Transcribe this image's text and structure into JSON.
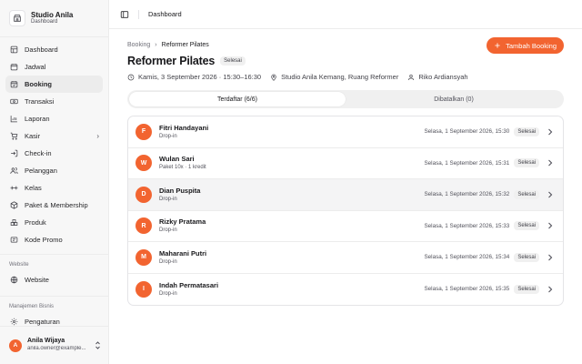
{
  "brand": {
    "name": "Studio Anila",
    "subtitle": "Dashboard"
  },
  "sidebar": {
    "items": [
      {
        "label": "Dashboard",
        "icon": "dashboard-icon"
      },
      {
        "label": "Jadwal",
        "icon": "calendar-icon"
      },
      {
        "label": "Booking",
        "icon": "booking-icon",
        "active": true
      },
      {
        "label": "Transaksi",
        "icon": "banknote-icon"
      },
      {
        "label": "Laporan",
        "icon": "chart-icon"
      },
      {
        "label": "Kasir",
        "icon": "cart-icon",
        "has_submenu": true
      },
      {
        "label": "Check-in",
        "icon": "checkin-icon"
      },
      {
        "label": "Pelanggan",
        "icon": "users-icon"
      },
      {
        "label": "Kelas",
        "icon": "dumbbell-icon"
      },
      {
        "label": "Paket & Membership",
        "icon": "package-icon"
      },
      {
        "label": "Produk",
        "icon": "product-icon"
      },
      {
        "label": "Kode Promo",
        "icon": "ticket-icon"
      }
    ],
    "website_section": {
      "label": "Website",
      "items": [
        {
          "label": "Website",
          "icon": "globe-icon"
        }
      ]
    },
    "business_section": {
      "label": "Manajemen Bisnis",
      "items": [
        {
          "label": "Pengaturan",
          "icon": "settings-icon"
        }
      ]
    }
  },
  "user": {
    "name": "Anila Wijaya",
    "email": "anila.owner@example...",
    "initial": "A"
  },
  "topbar": {
    "title": "Dashboard"
  },
  "breadcrumb": {
    "parent": "Booking",
    "current": "Reformer Pilates"
  },
  "page": {
    "title": "Reformer Pilates",
    "status": "Selesai",
    "datetime": "Kamis, 3 September 2026 · 15:30–16:30",
    "location": "Studio Anila Kemang, Ruang Reformer",
    "instructor": "Riko Ardiansyah",
    "add_button": "Tambah Booking"
  },
  "tabs": [
    {
      "label": "Terdaftar (6/6)",
      "active": true
    },
    {
      "label": "Dibatalkan (0)",
      "active": false
    }
  ],
  "bookings": [
    {
      "initial": "F",
      "name": "Fitri Handayani",
      "plan": "Drop-in",
      "time": "Selasa, 1 September 2026, 15:30",
      "status": "Selesai"
    },
    {
      "initial": "W",
      "name": "Wulan Sari",
      "plan": "Paket 10x · 1 kredit",
      "time": "Selasa, 1 September 2026, 15:31",
      "status": "Selesai"
    },
    {
      "initial": "D",
      "name": "Dian Puspita",
      "plan": "Drop-in",
      "time": "Selasa, 1 September 2026, 15:32",
      "status": "Selesai",
      "hover": true
    },
    {
      "initial": "R",
      "name": "Rizky Pratama",
      "plan": "Drop-in",
      "time": "Selasa, 1 September 2026, 15:33",
      "status": "Selesai"
    },
    {
      "initial": "M",
      "name": "Maharani Putri",
      "plan": "Drop-in",
      "time": "Selasa, 1 September 2026, 15:34",
      "status": "Selesai"
    },
    {
      "initial": "I",
      "name": "Indah Permatasari",
      "plan": "Drop-in",
      "time": "Selasa, 1 September 2026, 15:35",
      "status": "Selesai"
    }
  ],
  "colors": {
    "accent": "#f26430",
    "active_nav_bg": "#ececec",
    "badge_bg": "#f0f0f0"
  }
}
